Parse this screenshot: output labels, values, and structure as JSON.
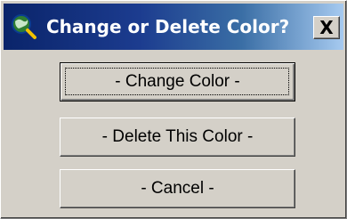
{
  "window": {
    "title": "Change or Delete Color?",
    "close_label": "X"
  },
  "icons": {
    "app": "globe-magnifier-icon",
    "close": "close-icon"
  },
  "buttons": {
    "change": "- Change Color -",
    "delete": "- Delete This Color -",
    "cancel": "- Cancel -"
  },
  "colors": {
    "titlebar_start": "#0a246a",
    "titlebar_end": "#a6caf0",
    "face": "#d4d0c8"
  }
}
